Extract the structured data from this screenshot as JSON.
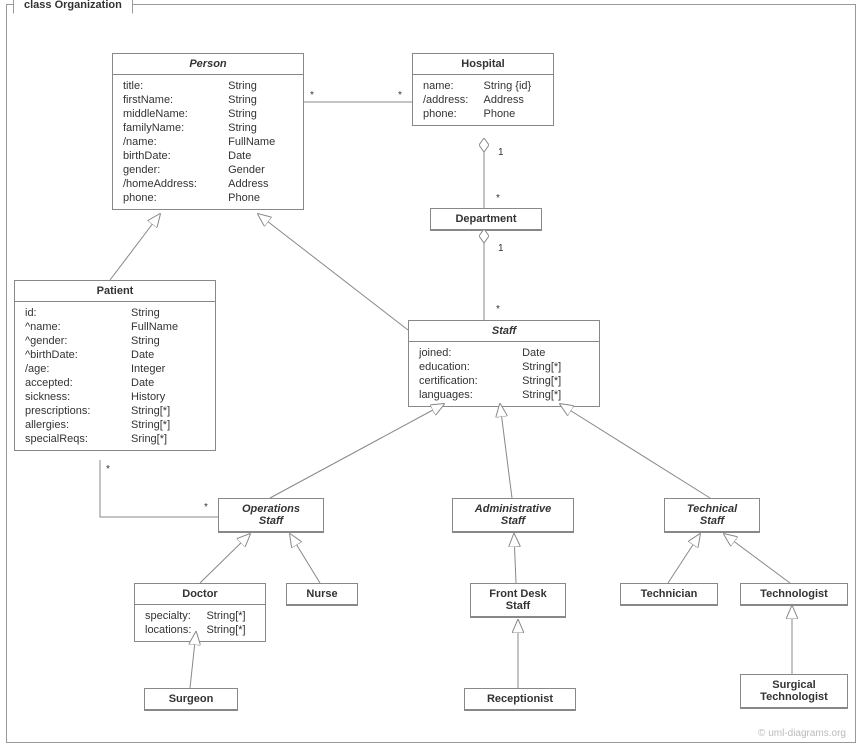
{
  "package": "class Organization",
  "watermark": "© uml-diagrams.org",
  "classes": {
    "person": {
      "name": "Person",
      "abstract": true,
      "attrs": [
        [
          "title:",
          "String"
        ],
        [
          "firstName:",
          "String"
        ],
        [
          "middleName:",
          "String"
        ],
        [
          "familyName:",
          "String"
        ],
        [
          "/name:",
          "FullName"
        ],
        [
          "birthDate:",
          "Date"
        ],
        [
          "gender:",
          "Gender"
        ],
        [
          "/homeAddress:",
          "Address"
        ],
        [
          "phone:",
          "Phone"
        ]
      ]
    },
    "hospital": {
      "name": "Hospital",
      "abstract": false,
      "attrs": [
        [
          "name:",
          "String {id}"
        ],
        [
          "/address:",
          "Address"
        ],
        [
          "phone:",
          "Phone"
        ]
      ]
    },
    "department": {
      "name": "Department",
      "abstract": false,
      "attrs": []
    },
    "patient": {
      "name": "Patient",
      "abstract": false,
      "attrs": [
        [
          "id:",
          "String"
        ],
        [
          "^name:",
          "FullName"
        ],
        [
          "^gender:",
          "String"
        ],
        [
          "^birthDate:",
          "Date"
        ],
        [
          "/age:",
          "Integer"
        ],
        [
          "accepted:",
          "Date"
        ],
        [
          "sickness:",
          "History"
        ],
        [
          "prescriptions:",
          "String[*]"
        ],
        [
          "allergies:",
          "String[*]"
        ],
        [
          "specialReqs:",
          "Sring[*]"
        ]
      ]
    },
    "staff": {
      "name": "Staff",
      "abstract": true,
      "attrs": [
        [
          "joined:",
          "Date"
        ],
        [
          "education:",
          "String[*]"
        ],
        [
          "certification:",
          "String[*]"
        ],
        [
          "languages:",
          "String[*]"
        ]
      ]
    },
    "opsStaff": {
      "name": "Operations\nStaff",
      "abstract": true,
      "attrs": []
    },
    "adminStaff": {
      "name": "Administrative\nStaff",
      "abstract": true,
      "attrs": []
    },
    "techStaff": {
      "name": "Technical\nStaff",
      "abstract": true,
      "attrs": []
    },
    "doctor": {
      "name": "Doctor",
      "abstract": false,
      "attrs": [
        [
          "specialty:",
          "String[*]"
        ],
        [
          "locations:",
          "String[*]"
        ]
      ]
    },
    "nurse": {
      "name": "Nurse",
      "abstract": false,
      "attrs": []
    },
    "frontDesk": {
      "name": "Front Desk\nStaff",
      "abstract": false,
      "attrs": []
    },
    "technician": {
      "name": "Technician",
      "abstract": false,
      "attrs": []
    },
    "technologist": {
      "name": "Technologist",
      "abstract": false,
      "attrs": []
    },
    "surgeon": {
      "name": "Surgeon",
      "abstract": false,
      "attrs": []
    },
    "receptionist": {
      "name": "Receptionist",
      "abstract": false,
      "attrs": []
    },
    "surgTech": {
      "name": "Surgical\nTechnologist",
      "abstract": false,
      "attrs": []
    }
  },
  "multiplicities": {
    "personHospL": "*",
    "personHospR": "*",
    "hospDept1": "1",
    "hospDeptStar": "*",
    "deptStaff1": "1",
    "deptStaffStar": "*",
    "opsPatientL": "*",
    "opsPatientR": "*"
  }
}
